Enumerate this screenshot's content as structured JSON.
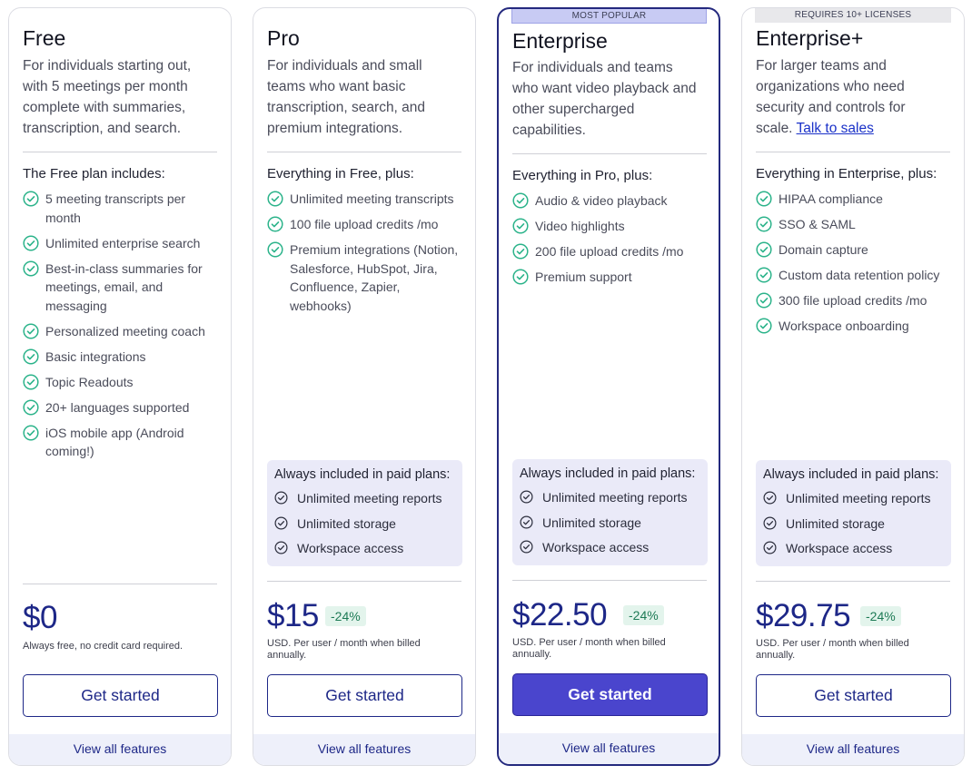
{
  "plans": [
    {
      "name": "Free",
      "badge": "",
      "description": "For individuals starting out, with 5 meetings per month complete with summaries, transcription, and search.",
      "includes_title": "The Free plan includes:",
      "features": [
        "5 meeting transcripts per month",
        "Unlimited enterprise search",
        "Best-in-class summaries for meetings, email, and messaging",
        "Personalized meeting coach",
        "Basic integrations",
        "Topic Readouts",
        "20+ languages supported",
        "iOS mobile app (Android coming!)"
      ],
      "price": "$0",
      "discount": "",
      "price_note": "Always free, no credit card required.",
      "cta": "Get started",
      "footer": "View all features"
    },
    {
      "name": "Pro",
      "badge": "",
      "description": "For individuals and small teams who want basic transcription, search, and premium integrations.",
      "includes_title": "Everything in Free, plus:",
      "features": [
        "Unlimited meeting transcripts",
        "100 file upload credits /mo",
        "Premium integrations (Notion, Salesforce, HubSpot, Jira, Confluence, Zapier, webhooks)"
      ],
      "always_title": "Always included in paid plans:",
      "always_items": [
        "Unlimited meeting reports",
        "Unlimited storage",
        "Workspace access"
      ],
      "price": "$15",
      "discount": "-24%",
      "price_note": "USD. Per user / month when billed annually.",
      "cta": "Get started",
      "footer": "View all features"
    },
    {
      "name": "Enterprise",
      "badge": "MOST POPULAR",
      "description": "For individuals and teams who want video playback and other supercharged capabilities.",
      "includes_title": "Everything in Pro, plus:",
      "features": [
        "Audio & video playback",
        "Video highlights",
        "200 file upload credits /mo",
        "Premium support"
      ],
      "always_title": "Always included in paid plans:",
      "always_items": [
        "Unlimited meeting reports",
        "Unlimited storage",
        "Workspace access"
      ],
      "price": "$22.50",
      "discount": "-24%",
      "price_note": "USD. Per user / month when billed annually.",
      "cta": "Get started",
      "footer": "View all features"
    },
    {
      "name": "Enterprise+",
      "badge": "REQUIRES 10+ LICENSES",
      "description": "For larger teams and organizations who need security and controls for scale.",
      "description_link": "Talk to sales",
      "includes_title": "Everything in Enterprise, plus:",
      "features": [
        "HIPAA compliance",
        "SSO & SAML",
        "Domain capture",
        "Custom data retention policy",
        "300 file upload credits /mo",
        "Workspace onboarding"
      ],
      "always_title": "Always included in paid plans:",
      "always_items": [
        "Unlimited meeting reports",
        "Unlimited storage",
        "Workspace access"
      ],
      "price": "$29.75",
      "discount": "-24%",
      "price_note": "USD. Per user / month when billed annually.",
      "cta": "Get started",
      "footer": "View all features"
    }
  ],
  "icons": {
    "feature_check": "check-circle-icon",
    "included_check": "check-circle-outline-icon"
  },
  "colors": {
    "accent": "#1d2787",
    "primary_button": "#4a45cd",
    "check_green": "#2bb38a",
    "discount_bg": "#e3f4ec",
    "discount_text": "#1d7a55",
    "included_bg": "#eaeaf8",
    "popular_badge_bg": "#c8cbf4"
  }
}
